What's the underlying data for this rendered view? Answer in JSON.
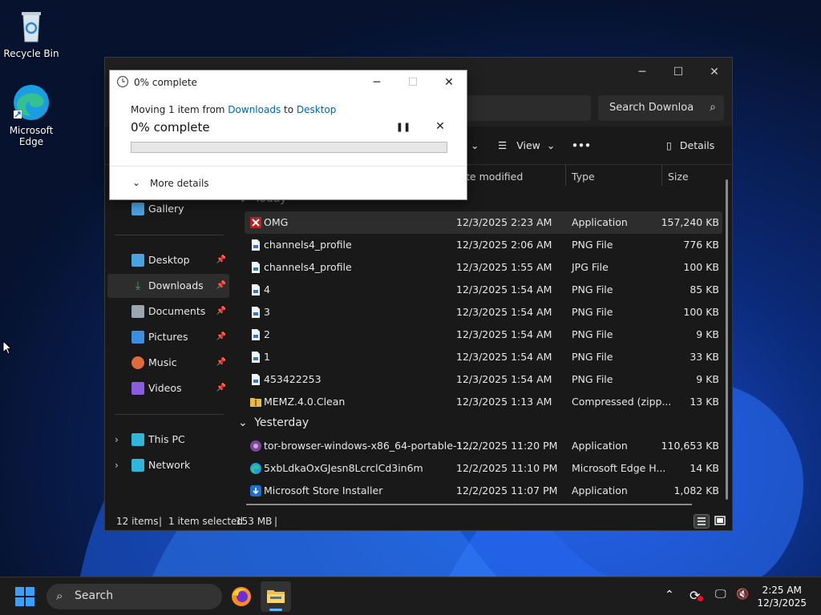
{
  "desktop": {
    "icons": [
      {
        "label": "Recycle Bin"
      },
      {
        "label": "Microsoft Edge"
      }
    ]
  },
  "explorer": {
    "search_placeholder": "Search Downloa",
    "toolbar": {
      "view_label": "View",
      "more_label": "•••",
      "details_label": "Details"
    },
    "nav": {
      "gallery": "Gallery",
      "quick_access": [
        {
          "label": "Desktop",
          "icon_color": "#4aa3df"
        },
        {
          "label": "Downloads",
          "icon_color": "#2bb673"
        },
        {
          "label": "Documents",
          "icon_color": "#9aa6b2"
        },
        {
          "label": "Pictures",
          "icon_color": "#3b8ee0"
        },
        {
          "label": "Music",
          "icon_color": "#e06a3b"
        },
        {
          "label": "Videos",
          "icon_color": "#8a5ce0"
        }
      ],
      "this_pc": "This PC",
      "network": "Network"
    },
    "columns": {
      "date": "te modified",
      "type": "Type",
      "size": "Size"
    },
    "groups": {
      "today": "Today",
      "yesterday": "Yesterday"
    },
    "files_today": [
      {
        "name": "OMG",
        "date": "12/3/2025 2:23 AM",
        "type": "Application",
        "size": "157,240 KB",
        "icon": "app-icon"
      },
      {
        "name": "channels4_profile",
        "date": "12/3/2025 2:06 AM",
        "type": "PNG File",
        "size": "776 KB",
        "icon": "image-file-icon"
      },
      {
        "name": "channels4_profile",
        "date": "12/3/2025 1:55 AM",
        "type": "JPG File",
        "size": "100 KB",
        "icon": "image-file-icon"
      },
      {
        "name": "4",
        "date": "12/3/2025 1:54 AM",
        "type": "PNG File",
        "size": "85 KB",
        "icon": "image-file-icon"
      },
      {
        "name": "3",
        "date": "12/3/2025 1:54 AM",
        "type": "PNG File",
        "size": "100 KB",
        "icon": "image-file-icon"
      },
      {
        "name": "2",
        "date": "12/3/2025 1:54 AM",
        "type": "PNG File",
        "size": "9 KB",
        "icon": "image-file-icon"
      },
      {
        "name": "1",
        "date": "12/3/2025 1:54 AM",
        "type": "PNG File",
        "size": "33 KB",
        "icon": "image-file-icon"
      },
      {
        "name": "453422253",
        "date": "12/3/2025 1:54 AM",
        "type": "PNG File",
        "size": "9 KB",
        "icon": "image-file-icon"
      },
      {
        "name": "MEMZ.4.0.Clean",
        "date": "12/3/2025 1:13 AM",
        "type": "Compressed (zipp...",
        "size": "13 KB",
        "icon": "zip-folder-icon"
      }
    ],
    "files_yesterday": [
      {
        "name": "tor-browser-windows-x86_64-portable-1...",
        "date": "12/2/2025 11:20 PM",
        "type": "Application",
        "size": "110,653 KB",
        "icon": "tor-icon"
      },
      {
        "name": "5xbLdkaOxGJesn8LcrclCd3in6m",
        "date": "12/2/2025 11:10 PM",
        "type": "Microsoft Edge H...",
        "size": "14 KB",
        "icon": "edge-icon"
      },
      {
        "name": "Microsoft Store Installer",
        "date": "12/2/2025 11:07 PM",
        "type": "Application",
        "size": "1,082 KB",
        "icon": "store-installer-icon"
      }
    ],
    "status": {
      "items": "12 items",
      "selected": "1 item selected",
      "size": "153 MB"
    }
  },
  "copy_dialog": {
    "title": "0% complete",
    "moving_prefix": "Moving 1 item from",
    "source": "Downloads",
    "to_word": "to",
    "destination": "Desktop",
    "percent_label": "0% complete",
    "progress": 0,
    "more_details": "More details"
  },
  "taskbar": {
    "search_label": "Search",
    "time": "2:25 AM",
    "date": "12/3/2025"
  }
}
